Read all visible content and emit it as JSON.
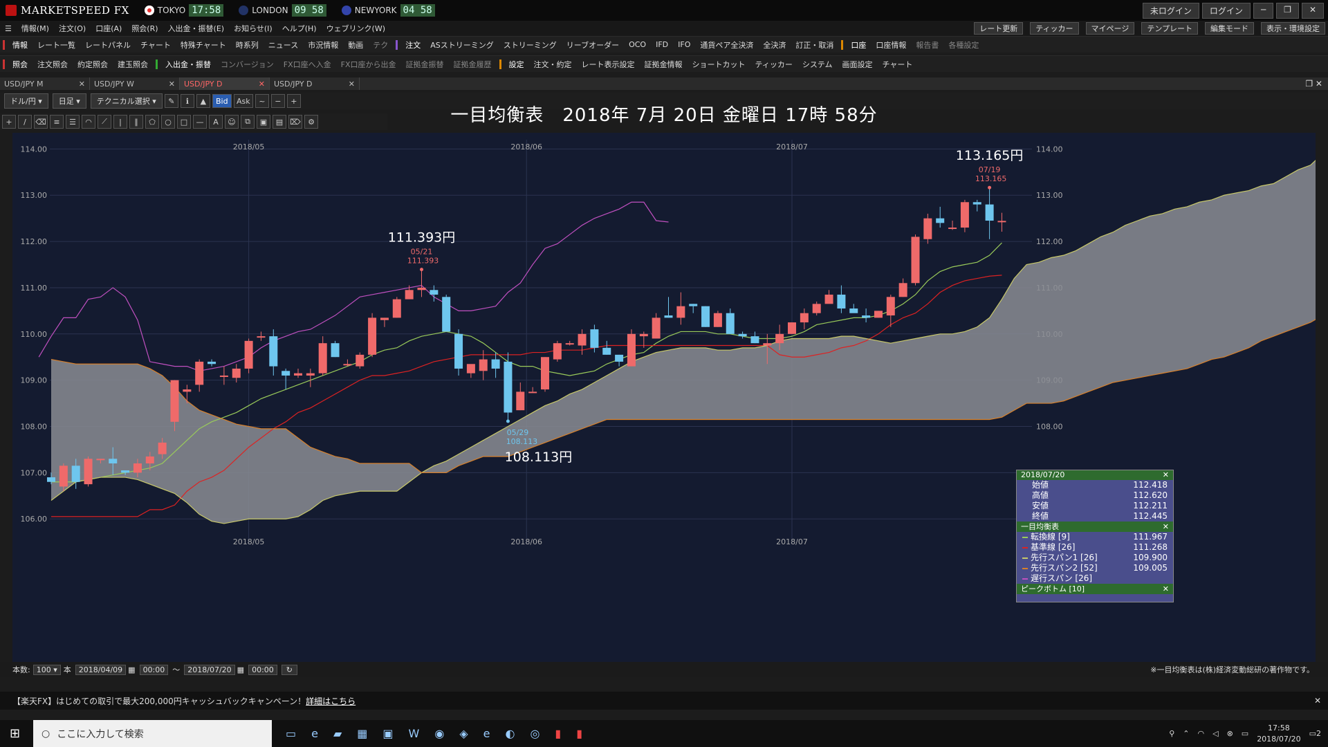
{
  "app": {
    "brand": "MARKETSPEED FX",
    "clocks": [
      {
        "city": "TOKYO",
        "time": "17:58",
        "color": "#e33"
      },
      {
        "city": "LONDON",
        "time": "09 58",
        "color": "#36c"
      },
      {
        "city": "NEWYORK",
        "time": "04 58",
        "color": "#36c"
      }
    ],
    "login_status": "未ログイン",
    "login_button": "ログイン"
  },
  "menu": [
    "情報(M)",
    "注文(O)",
    "口座(A)",
    "照会(R)",
    "入出金・振替(E)",
    "お知らせ(I)",
    "ヘルプ(H)",
    "ウェブリンク(W)"
  ],
  "toolbar_right": [
    "レート更新",
    "ティッカー",
    "マイページ",
    "テンプレート",
    "編集モード",
    "表示・環境設定"
  ],
  "row1": {
    "group1_label": "情報",
    "items": [
      "レート一覧",
      "レートパネル",
      "チャート",
      "特殊チャート",
      "時系列",
      "ニュース",
      "市況情報",
      "動画",
      "テク"
    ],
    "group2_label": "注文",
    "items2": [
      "ASストリーミング",
      "ストリーミング",
      "リーブオーダー",
      "OCO",
      "IFD",
      "IFO",
      "通貨ペア全決済",
      "全決済",
      "訂正・取消"
    ],
    "group3_label": "口座",
    "items3": [
      "口座情報",
      "報告書",
      "各種設定"
    ]
  },
  "row2": {
    "group1_label": "照会",
    "items": [
      "注文照会",
      "約定照会",
      "建玉照会"
    ],
    "group2_label": "入出金・振替",
    "items2": [
      "コンバージョン",
      "FX口座へ入金",
      "FX口座から出金",
      "証拠金振替",
      "証拠金履歴"
    ],
    "group3_label": "設定",
    "items3": [
      "注文・約定",
      "レート表示設定",
      "証拠金情報",
      "ショートカット",
      "ティッカー",
      "システム",
      "画面設定",
      "チャート"
    ]
  },
  "tabs": [
    "USD/JPY M",
    "USD/JPY W",
    "USD/JPY D",
    "USD/JPY D"
  ],
  "chart_toolbar": {
    "pair": "ドル/円",
    "period": "日足",
    "technical": "テクニカル選択",
    "bid": "Bid",
    "ask": "Ask"
  },
  "chart_title": "一目均衡表　2018年 7月 20日 金曜日 17時 58分",
  "chart_data": {
    "type": "candlestick",
    "title": "一目均衡表",
    "x_ticks": [
      "2018/05",
      "2018/06",
      "2018/07"
    ],
    "y_ticks": [
      "114.00",
      "113.00",
      "112.00",
      "111.00",
      "110.00",
      "109.00",
      "108.00",
      "107.00",
      "106.00"
    ],
    "ylim": [
      105.45,
      114.2
    ],
    "candles": [
      [
        106.9,
        107.0,
        106.75,
        106.8
      ],
      [
        106.7,
        107.2,
        106.6,
        107.15
      ],
      [
        107.15,
        107.3,
        106.65,
        106.8
      ],
      [
        106.75,
        107.35,
        106.7,
        107.3
      ],
      [
        107.3,
        107.3,
        107.2,
        107.3
      ],
      [
        107.3,
        107.55,
        106.95,
        107.2
      ],
      [
        107.05,
        107.05,
        106.95,
        107.0
      ],
      [
        107.0,
        107.3,
        106.9,
        107.2
      ],
      [
        107.2,
        107.45,
        107.05,
        107.35
      ],
      [
        107.4,
        107.75,
        107.3,
        107.65
      ],
      [
        108.1,
        109.0,
        107.9,
        109.0
      ],
      [
        108.75,
        108.9,
        108.5,
        108.8
      ],
      [
        108.9,
        109.45,
        108.75,
        109.4
      ],
      [
        109.4,
        109.45,
        109.3,
        109.35
      ],
      [
        109.1,
        109.3,
        108.9,
        109.1
      ],
      [
        109.05,
        109.35,
        108.95,
        109.25
      ],
      [
        109.25,
        109.9,
        109.15,
        109.85
      ],
      [
        109.95,
        110.05,
        109.85,
        109.95
      ],
      [
        109.95,
        110.1,
        109.1,
        109.3
      ],
      [
        109.2,
        109.25,
        108.8,
        109.1
      ],
      [
        109.1,
        109.25,
        109.05,
        109.15
      ],
      [
        109.1,
        109.25,
        108.85,
        109.15
      ],
      [
        109.15,
        109.95,
        109.1,
        109.8
      ],
      [
        109.8,
        109.85,
        109.5,
        109.5
      ],
      [
        109.35,
        109.45,
        109.3,
        109.35
      ],
      [
        109.3,
        109.6,
        109.25,
        109.55
      ],
      [
        109.55,
        110.45,
        109.5,
        110.35
      ],
      [
        110.3,
        110.35,
        110.15,
        110.35
      ],
      [
        110.35,
        110.8,
        110.35,
        110.75
      ],
      [
        110.75,
        111.05,
        110.8,
        110.95
      ],
      [
        110.95,
        111.393,
        110.8,
        111.0
      ],
      [
        110.95,
        111.05,
        110.7,
        110.85
      ],
      [
        110.8,
        110.85,
        110.05,
        110.05
      ],
      [
        110.0,
        110.1,
        109.1,
        109.25
      ],
      [
        109.15,
        109.3,
        109.05,
        109.35
      ],
      [
        109.2,
        109.65,
        109.0,
        109.45
      ],
      [
        109.45,
        109.6,
        109.05,
        109.25
      ],
      [
        109.4,
        109.6,
        108.113,
        108.3
      ],
      [
        108.35,
        108.95,
        108.35,
        108.75
      ],
      [
        108.75,
        108.85,
        108.75,
        108.75
      ],
      [
        108.8,
        109.5,
        108.75,
        109.5
      ],
      [
        109.45,
        109.85,
        109.4,
        109.8
      ],
      [
        109.8,
        109.85,
        109.75,
        109.8
      ],
      [
        109.75,
        110.1,
        109.55,
        110.0
      ],
      [
        110.1,
        110.2,
        109.6,
        109.7
      ],
      [
        109.7,
        109.85,
        109.55,
        109.55
      ],
      [
        109.55,
        109.55,
        109.3,
        109.4
      ],
      [
        109.3,
        110.1,
        109.3,
        110.0
      ],
      [
        109.95,
        110.05,
        109.7,
        110.0
      ],
      [
        109.9,
        110.45,
        109.9,
        110.35
      ],
      [
        110.4,
        110.8,
        110.35,
        110.35
      ],
      [
        110.35,
        110.9,
        110.2,
        110.6
      ],
      [
        110.65,
        110.65,
        110.45,
        110.6
      ],
      [
        110.6,
        110.6,
        110.15,
        110.15
      ],
      [
        110.15,
        110.5,
        110.15,
        110.45
      ],
      [
        110.45,
        110.55,
        110.05,
        110.0
      ],
      [
        110.0,
        110.05,
        109.9,
        109.95
      ],
      [
        109.95,
        110.05,
        109.8,
        109.8
      ],
      [
        109.75,
        110.0,
        109.35,
        109.8
      ],
      [
        109.8,
        110.2,
        109.65,
        110.0
      ],
      [
        110.0,
        110.25,
        110.0,
        110.25
      ],
      [
        110.25,
        110.55,
        110.1,
        110.45
      ],
      [
        110.45,
        110.7,
        110.4,
        110.65
      ],
      [
        110.65,
        110.95,
        110.7,
        110.85
      ],
      [
        110.85,
        111.05,
        110.45,
        110.55
      ],
      [
        110.55,
        110.65,
        110.5,
        110.45
      ],
      [
        110.4,
        110.55,
        110.25,
        110.35
      ],
      [
        110.35,
        110.5,
        110.35,
        110.5
      ],
      [
        110.4,
        110.85,
        110.15,
        110.8
      ],
      [
        110.8,
        111.2,
        110.8,
        111.1
      ],
      [
        111.1,
        112.15,
        111.05,
        112.1
      ],
      [
        112.05,
        112.6,
        111.95,
        112.5
      ],
      [
        112.5,
        112.75,
        112.3,
        112.4
      ],
      [
        112.3,
        112.45,
        112.25,
        112.3
      ],
      [
        112.3,
        112.9,
        112.2,
        112.85
      ],
      [
        112.85,
        112.9,
        112.65,
        112.8
      ],
      [
        112.8,
        113.165,
        112.05,
        112.45
      ],
      [
        112.418,
        112.62,
        112.211,
        112.445
      ]
    ],
    "series": [
      {
        "name": "転換線",
        "color": "#9acb5a",
        "values": [
          106.8,
          106.8,
          106.8,
          106.85,
          106.9,
          106.95,
          107.0,
          107.05,
          107.1,
          107.2,
          107.45,
          107.7,
          107.95,
          108.1,
          108.2,
          108.3,
          108.45,
          108.6,
          108.7,
          108.8,
          108.9,
          109.0,
          109.1,
          109.2,
          109.3,
          109.4,
          109.55,
          109.65,
          109.7,
          109.85,
          109.95,
          110.0,
          110.05,
          110.0,
          109.95,
          109.8,
          109.6,
          109.4,
          109.3,
          109.3,
          109.2,
          109.15,
          109.1,
          109.15,
          109.2,
          109.35,
          109.45,
          109.55,
          109.6,
          109.8,
          109.95,
          110.05,
          110.05,
          110.05,
          110.0,
          110.0,
          109.95,
          109.9,
          109.9,
          109.9,
          109.95,
          110.05,
          110.2,
          110.25,
          110.3,
          110.35,
          110.35,
          110.4,
          110.5,
          110.65,
          110.85,
          111.15,
          111.35,
          111.45,
          111.5,
          111.55,
          111.7,
          111.97
        ]
      },
      {
        "name": "基準線",
        "color": "#d22",
        "values": [
          106.05,
          106.05,
          106.05,
          106.05,
          106.05,
          106.05,
          106.05,
          106.05,
          106.2,
          106.2,
          106.3,
          106.6,
          106.8,
          106.9,
          107.05,
          107.3,
          107.55,
          107.75,
          107.95,
          108.1,
          108.3,
          108.4,
          108.55,
          108.7,
          108.85,
          109.0,
          109.1,
          109.1,
          109.15,
          109.2,
          109.3,
          109.4,
          109.45,
          109.5,
          109.55,
          109.55,
          109.55,
          109.55,
          109.55,
          109.6,
          109.6,
          109.65,
          109.65,
          109.65,
          109.7,
          109.75,
          109.75,
          109.75,
          109.75,
          109.75,
          109.75,
          109.75,
          109.75,
          109.75,
          109.75,
          109.75,
          109.75,
          109.75,
          109.75,
          109.55,
          109.5,
          109.5,
          109.55,
          109.6,
          109.7,
          109.75,
          109.85,
          110.0,
          110.2,
          110.35,
          110.45,
          110.65,
          110.9,
          111.05,
          111.15,
          111.2,
          111.25,
          111.27
        ]
      },
      {
        "name": "先行スパン1",
        "color": "#c8c86a",
        "values": [
          106.4,
          106.6,
          106.8,
          106.85,
          106.9,
          106.9,
          106.9,
          106.85,
          106.75,
          106.65,
          106.55,
          106.35,
          106.1,
          105.95,
          105.9,
          105.95,
          106.0,
          106.0,
          106.0,
          106.0,
          106.05,
          106.2,
          106.4,
          106.5,
          106.55,
          106.6,
          106.6,
          106.6,
          106.6,
          106.8,
          107.0,
          107.15,
          107.25,
          107.4,
          107.55,
          107.7,
          107.85,
          108.0,
          108.15,
          108.3,
          108.45,
          108.55,
          108.7,
          108.8,
          108.95,
          109.1,
          109.25,
          109.4,
          109.5,
          109.6,
          109.65,
          109.7,
          109.7,
          109.7,
          109.65,
          109.65,
          109.7,
          109.7,
          109.75,
          109.85,
          109.9,
          109.9,
          109.9,
          109.9,
          109.95,
          109.95,
          109.9,
          109.85,
          109.8,
          109.85,
          109.9,
          109.95,
          110.0,
          110.0,
          110.05,
          110.15,
          110.35,
          110.75,
          111.2,
          111.5,
          111.55,
          111.65,
          111.7,
          111.8,
          111.95,
          112.1,
          112.2,
          112.35,
          112.45,
          112.55,
          112.6,
          112.7,
          112.75,
          112.85,
          112.9,
          113.0,
          113.05,
          113.1,
          113.2,
          113.25,
          113.4,
          113.55,
          113.65,
          113.9
        ]
      },
      {
        "name": "先行スパン2",
        "color": "#d8802a",
        "values": [
          109.45,
          109.4,
          109.35,
          109.35,
          109.35,
          109.35,
          109.35,
          109.35,
          109.25,
          109.1,
          108.85,
          108.55,
          108.35,
          108.25,
          108.15,
          108.05,
          108.0,
          107.95,
          107.95,
          107.95,
          107.75,
          107.55,
          107.45,
          107.35,
          107.3,
          107.2,
          107.2,
          107.2,
          107.2,
          107.2,
          107.0,
          107.0,
          107.0,
          107.15,
          107.25,
          107.35,
          107.35,
          107.35,
          107.45,
          107.55,
          107.65,
          107.75,
          107.85,
          107.95,
          108.05,
          108.15,
          108.15,
          108.15,
          108.15,
          108.15,
          108.15,
          108.15,
          108.15,
          108.15,
          108.15,
          108.15,
          108.15,
          108.15,
          108.15,
          108.15,
          108.15,
          108.15,
          108.15,
          108.15,
          108.15,
          108.15,
          108.15,
          108.15,
          108.15,
          108.15,
          108.15,
          108.15,
          108.15,
          108.15,
          108.15,
          108.15,
          108.15,
          108.2,
          108.35,
          108.5,
          108.5,
          108.5,
          108.55,
          108.65,
          108.75,
          108.85,
          108.95,
          109.0,
          109.05,
          109.1,
          109.15,
          109.2,
          109.25,
          109.35,
          109.45,
          109.5,
          109.6,
          109.7,
          109.85,
          109.95,
          110.05,
          110.15,
          110.25,
          110.4
        ]
      },
      {
        "name": "遅行スパン",
        "color": "#c050c0",
        "values": [
          109.5,
          109.95,
          110.35,
          110.35,
          110.75,
          110.8,
          111.0,
          110.8,
          110.3,
          109.4,
          109.35,
          109.3,
          109.3,
          109.2,
          109.25,
          109.3,
          109.4,
          109.5,
          109.7,
          109.85,
          109.95,
          110.05,
          110.1,
          110.25,
          110.4,
          110.6,
          110.8,
          110.85,
          110.9,
          110.95,
          111.0,
          111.05,
          110.8,
          110.65,
          110.5,
          110.5,
          110.55,
          110.6,
          110.9,
          111.1,
          111.5,
          111.85,
          111.95,
          112.15,
          112.35,
          112.5,
          112.6,
          112.7,
          112.85,
          112.85,
          112.45,
          112.42
        ]
      }
    ],
    "annotations": [
      {
        "label": "111.393円",
        "date": "05/21",
        "value": "111.393"
      },
      {
        "label": "108.113円",
        "date": "05/29",
        "value": "108.113"
      },
      {
        "label": "113.165円",
        "date": "07/19",
        "value": "113.165"
      }
    ]
  },
  "info_panel": {
    "date": "2018/07/20",
    "ohlc": [
      [
        "始値",
        "112.418"
      ],
      [
        "高値",
        "112.620"
      ],
      [
        "安値",
        "112.211"
      ],
      [
        "終値",
        "112.445"
      ]
    ],
    "ichimoku_label": "一目均衡表",
    "lines": [
      [
        "転換線 [9]",
        "111.967",
        "#9acb5a"
      ],
      [
        "基準線 [26]",
        "111.268",
        "#d22"
      ],
      [
        "先行スパン1 [26]",
        "109.900",
        "#c8c86a"
      ],
      [
        "先行スパン2 [52]",
        "109.005",
        "#d8802a"
      ],
      [
        "遅行スパン [26]",
        "",
        "#c050c0"
      ]
    ],
    "peak_label": "ピークボトム [10]"
  },
  "bottom": {
    "count_label": "本数:",
    "count": "100",
    "unit": "本",
    "from": "2018/04/09",
    "from_time": "00:00",
    "tilde": "〜",
    "to": "2018/07/20",
    "to_time": "00:00",
    "copyright": "※一目均衡表は(株)経済変動総研の著作物です。"
  },
  "campaign": {
    "text": "【楽天FX】はじめての取引で最大200,000円キャッシュバックキャンペーン！",
    "link": "詳細はこちら"
  },
  "taskbar": {
    "search_placeholder": "ここに入力して検索",
    "time": "17:58",
    "date": "2018/07/20",
    "notif": "2"
  }
}
